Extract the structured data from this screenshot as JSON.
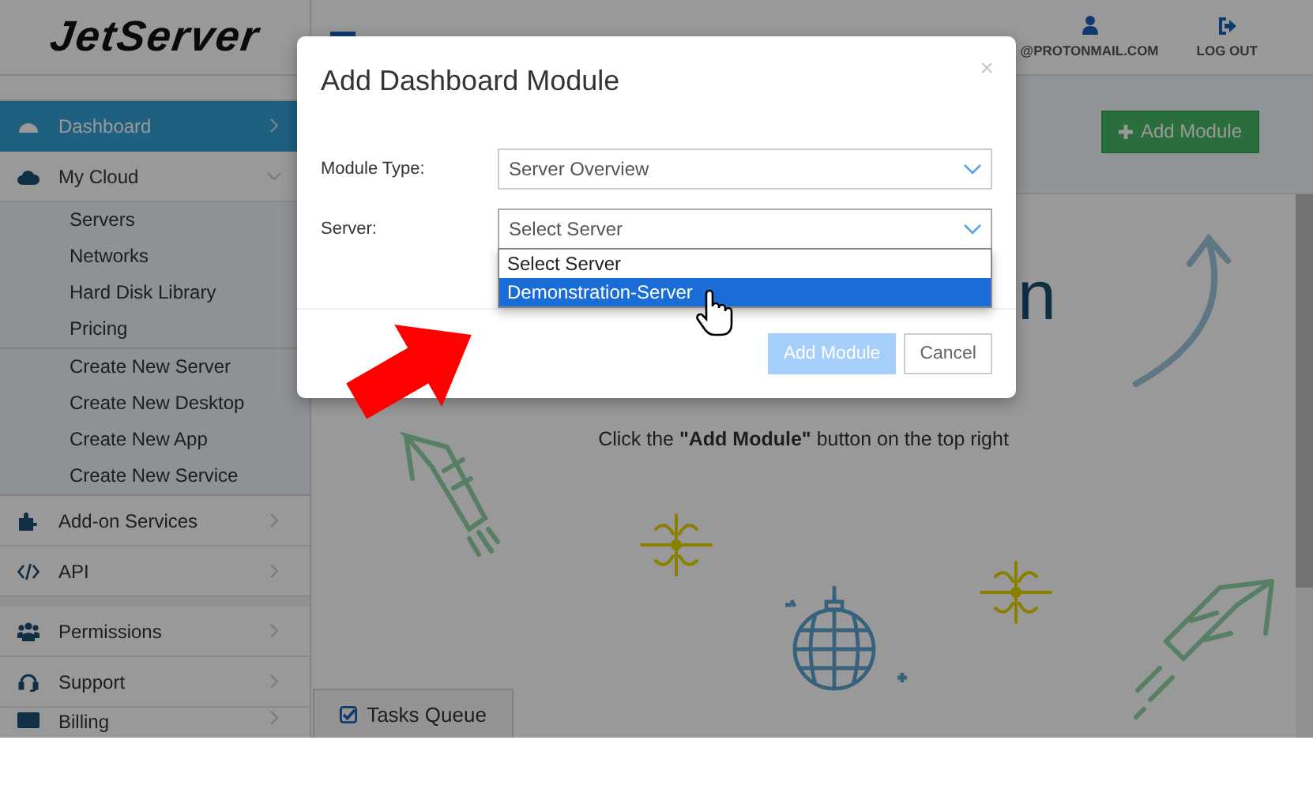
{
  "header": {
    "logo": "JetServer",
    "user_email": "@PROTONMAIL.COM",
    "logout": "LOG OUT"
  },
  "sidebar": {
    "groups": [
      {
        "items": [
          {
            "label": "Dashboard",
            "selected": true,
            "expanded": false
          },
          {
            "label": "My Cloud",
            "selected": false,
            "expanded": true,
            "children": [
              {
                "label": "Servers",
                "separator_above": false
              },
              {
                "label": "Networks",
                "separator_above": false
              },
              {
                "label": "Hard Disk Library",
                "separator_above": false
              },
              {
                "label": "Pricing",
                "separator_above": false
              },
              {
                "label": "Create New Server",
                "separator_above": true
              },
              {
                "label": "Create New Desktop",
                "separator_above": false
              },
              {
                "label": "Create New App",
                "separator_above": false
              },
              {
                "label": "Create New Service",
                "separator_above": false
              }
            ]
          },
          {
            "label": "Add-on Services",
            "selected": false,
            "expanded": false
          },
          {
            "label": "API",
            "selected": false,
            "expanded": false
          }
        ]
      },
      {
        "items": [
          {
            "label": "Permissions",
            "selected": false,
            "expanded": false
          },
          {
            "label": "Support",
            "selected": false,
            "expanded": false
          },
          {
            "label": "Billing",
            "selected": false,
            "expanded": false
          }
        ]
      }
    ]
  },
  "main": {
    "add_button": "Add Module",
    "heading": "n",
    "hint": "Click the **\"Add Module\"** button on the top right",
    "tasks_tab": "Tasks Queue"
  },
  "modal": {
    "title": "Add Dashboard Module",
    "close": "×",
    "fields": [
      {
        "label": "Module Type:",
        "value": "Server Overview"
      },
      {
        "label": "Server:",
        "value": "Select Server",
        "expanded": true,
        "options": [
          {
            "label": "Select Server",
            "highlighted": false
          },
          {
            "label": "Demonstration-Server",
            "highlighted": true
          }
        ]
      }
    ],
    "buttons": [
      {
        "label": "Add Module",
        "disabled": true
      },
      {
        "label": "Cancel",
        "disabled": false
      }
    ]
  }
}
